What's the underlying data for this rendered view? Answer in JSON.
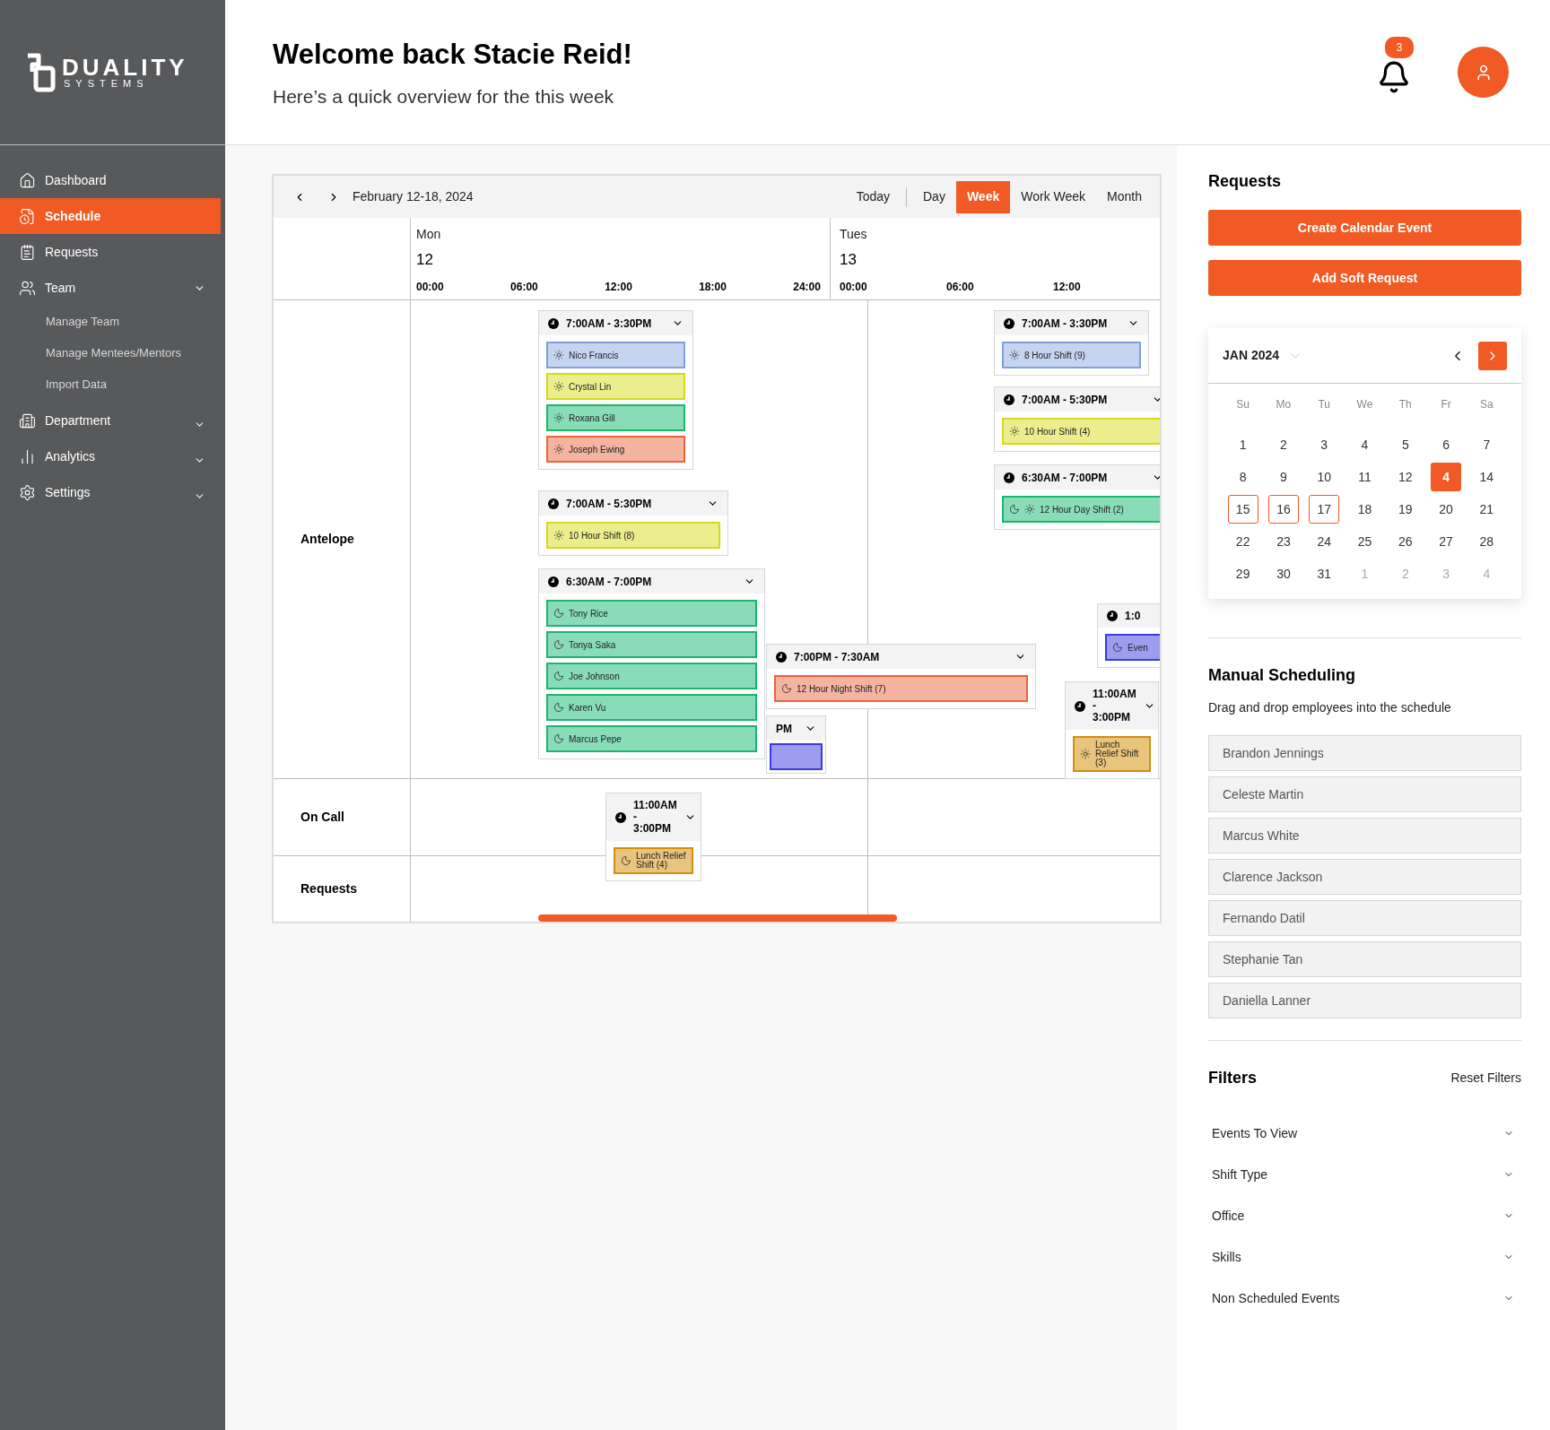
{
  "brand": {
    "name": "DUALITY",
    "tagline": "SYSTEMS"
  },
  "sidebar": {
    "items": [
      {
        "label": "Dashboard",
        "selected": false
      },
      {
        "label": "Schedule",
        "selected": true
      },
      {
        "label": "Requests",
        "selected": false
      },
      {
        "label": "Team",
        "selected": false,
        "expanded": true,
        "children": [
          {
            "label": "Manage Team"
          },
          {
            "label": "Manage Mentees/Mentors"
          },
          {
            "label": "Import Data"
          }
        ]
      },
      {
        "label": "Department",
        "selected": false,
        "expanded": false
      },
      {
        "label": "Analytics",
        "selected": false,
        "expanded": false
      },
      {
        "label": "Settings",
        "selected": false,
        "expanded": false
      }
    ]
  },
  "header": {
    "title": "Welcome back Stacie Reid!",
    "subtitle": "Here’s a quick overview for the this week",
    "notifications": "3"
  },
  "schedule": {
    "range": "February 12-18, 2024",
    "views": [
      {
        "label": "Today",
        "selected": false
      },
      {
        "label": "Day",
        "selected": false
      },
      {
        "label": "Week",
        "selected": true
      },
      {
        "label": "Work Week",
        "selected": false
      },
      {
        "label": "Month",
        "selected": false
      }
    ],
    "days": [
      {
        "name": "Mon",
        "date": "12",
        "ticks": [
          "00:00",
          "06:00",
          "12:00",
          "18:00",
          "24:00"
        ]
      },
      {
        "name": "Tues",
        "date": "13",
        "ticks": [
          "00:00",
          "06:00",
          "12:00"
        ]
      }
    ],
    "rows": [
      {
        "label": "Antelope"
      },
      {
        "label": "On Call"
      },
      {
        "label": "Requests"
      }
    ],
    "events": [
      {
        "time": "7:00AM - 3:30PM",
        "clock": true,
        "items": [
          {
            "name": "Nico Francis",
            "color": "#c5d5f0",
            "kind": "day"
          },
          {
            "name": "Crystal Lin",
            "color": "#ecee8e",
            "kind": "day"
          },
          {
            "name": "Roxana Gill",
            "color": "#88ddb8",
            "kind": "day"
          },
          {
            "name": "Joseph Ewing",
            "color": "#f4b4a0",
            "kind": "day"
          }
        ]
      },
      {
        "time": "7:00AM - 5:30PM",
        "clock": true,
        "items": [
          {
            "name": "10 Hour Shift (8)",
            "color": "#ecee8e",
            "kind": "day"
          }
        ]
      },
      {
        "time": "6:30AM - 7:00PM",
        "clock": true,
        "items": [
          {
            "name": "Tony Rice",
            "color": "#88ddb8",
            "kind": "night"
          },
          {
            "name": "Tonya Saka",
            "color": "#88ddb8",
            "kind": "night"
          },
          {
            "name": "Joe Johnson",
            "color": "#88ddb8",
            "kind": "night"
          },
          {
            "name": "Karen Vu",
            "color": "#88ddb8",
            "kind": "night"
          },
          {
            "name": "Marcus Pepe",
            "color": "#88ddb8",
            "kind": "night"
          }
        ]
      },
      {
        "time": "7:00PM - 7:30AM",
        "clock": true,
        "items": [
          {
            "name": "12 Hour Night Shift (7)",
            "color": "#f4b4a0",
            "kind": "night"
          }
        ]
      },
      {
        "time": "PM",
        "clock": false,
        "items": [
          {
            "color": "#9d9df0",
            "kind": "blank"
          }
        ]
      },
      {
        "time": "7:00AM - 3:30PM",
        "clock": true,
        "items": [
          {
            "name": "8 Hour Shift (9)",
            "color": "#c5d5f0",
            "kind": "day"
          }
        ]
      },
      {
        "time": "7:00AM - 5:30PM",
        "clock": true,
        "items": [
          {
            "name": "10 Hour Shift (4)",
            "color": "#ecee8e",
            "kind": "day"
          }
        ]
      },
      {
        "time": "6:30AM - 7:00PM",
        "clock": true,
        "items": [
          {
            "name": "12 Hour Day Shift (2)",
            "color": "#88ddb8",
            "kind": "both"
          }
        ]
      },
      {
        "time": "1:0",
        "clock": true,
        "items": [
          {
            "name": "Even",
            "color": "#9d9df0",
            "kind": "night"
          }
        ]
      },
      {
        "time": "11:00AM - 3:00PM",
        "clock": true,
        "items": [
          {
            "name": "Lunch Relief Shift (3)",
            "color": "#e8c47c",
            "kind": "day"
          }
        ]
      },
      {
        "time": "11:00AM - 3:00PM",
        "clock": true,
        "items": [
          {
            "name": "Lunch Relief Shift (4)",
            "color": "#e8c47c",
            "kind": "night"
          }
        ]
      }
    ]
  },
  "requests": {
    "title": "Requests",
    "buttons": [
      "Create Calendar Event",
      "Add Soft Request"
    ]
  },
  "mini_calendar": {
    "month": "JAN 2024",
    "weekdays": [
      "Su",
      "Mo",
      "Tu",
      "We",
      "Th",
      "Fr",
      "Sa"
    ],
    "weeks": [
      [
        {
          "label": "1",
          "selected": false,
          "marked": false,
          "outside": false
        },
        {
          "label": "2",
          "selected": false,
          "marked": false,
          "outside": false
        },
        {
          "label": "3",
          "selected": false,
          "marked": false,
          "outside": false
        },
        {
          "label": "4",
          "selected": false,
          "marked": false,
          "outside": false
        },
        {
          "label": "5",
          "selected": false,
          "marked": false,
          "outside": false
        },
        {
          "label": "6",
          "selected": false,
          "marked": false,
          "outside": false
        },
        {
          "label": "7",
          "selected": false,
          "marked": false,
          "outside": false
        }
      ],
      [
        {
          "label": "8",
          "selected": false,
          "marked": false,
          "outside": false
        },
        {
          "label": "9",
          "selected": false,
          "marked": false,
          "outside": false
        },
        {
          "label": "10",
          "selected": false,
          "marked": false,
          "outside": false
        },
        {
          "label": "11",
          "selected": false,
          "marked": false,
          "outside": false
        },
        {
          "label": "12",
          "selected": false,
          "marked": false,
          "outside": false
        },
        {
          "label": "4",
          "selected": true,
          "marked": false,
          "outside": false
        },
        {
          "label": "14",
          "selected": false,
          "marked": false,
          "outside": false
        }
      ],
      [
        {
          "label": "15",
          "selected": false,
          "marked": true,
          "outside": false
        },
        {
          "label": "16",
          "selected": false,
          "marked": true,
          "outside": false
        },
        {
          "label": "17",
          "selected": false,
          "marked": true,
          "outside": false
        },
        {
          "label": "18",
          "selected": false,
          "marked": false,
          "outside": false
        },
        {
          "label": "19",
          "selected": false,
          "marked": false,
          "outside": false
        },
        {
          "label": "20",
          "selected": false,
          "marked": false,
          "outside": false
        },
        {
          "label": "21",
          "selected": false,
          "marked": false,
          "outside": false
        }
      ],
      [
        {
          "label": "22",
          "selected": false,
          "marked": false,
          "outside": false
        },
        {
          "label": "23",
          "selected": false,
          "marked": false,
          "outside": false
        },
        {
          "label": "24",
          "selected": false,
          "marked": false,
          "outside": false
        },
        {
          "label": "25",
          "selected": false,
          "marked": false,
          "outside": false
        },
        {
          "label": "26",
          "selected": false,
          "marked": false,
          "outside": false
        },
        {
          "label": "27",
          "selected": false,
          "marked": false,
          "outside": false
        },
        {
          "label": "28",
          "selected": false,
          "marked": false,
          "outside": false
        }
      ],
      [
        {
          "label": "29",
          "selected": false,
          "marked": false,
          "outside": false
        },
        {
          "label": "30",
          "selected": false,
          "marked": false,
          "outside": false
        },
        {
          "label": "31",
          "selected": false,
          "marked": false,
          "outside": false
        },
        {
          "label": "1",
          "selected": false,
          "marked": false,
          "outside": true
        },
        {
          "label": "2",
          "selected": false,
          "marked": false,
          "outside": true
        },
        {
          "label": "3",
          "selected": false,
          "marked": false,
          "outside": true
        },
        {
          "label": "4",
          "selected": false,
          "marked": false,
          "outside": true
        }
      ]
    ]
  },
  "manual_scheduling": {
    "title": "Manual Scheduling",
    "hint": "Drag and drop employees into the schedule",
    "employees": [
      "Brandon Jennings",
      "Celeste Martin",
      "Marcus White",
      "Clarence Jackson",
      "Fernando Datil",
      "Stephanie Tan",
      "Daniella Lanner"
    ]
  },
  "filters": {
    "title": "Filters",
    "reset": "Reset Filters",
    "items": [
      {
        "label": "Events To View",
        "expanded": false
      },
      {
        "label": "Shift Type",
        "expanded": false
      },
      {
        "label": "Office",
        "expanded": false
      },
      {
        "label": "Skills",
        "expanded": false
      },
      {
        "label": "Non Scheduled Events",
        "expanded": false
      }
    ]
  }
}
